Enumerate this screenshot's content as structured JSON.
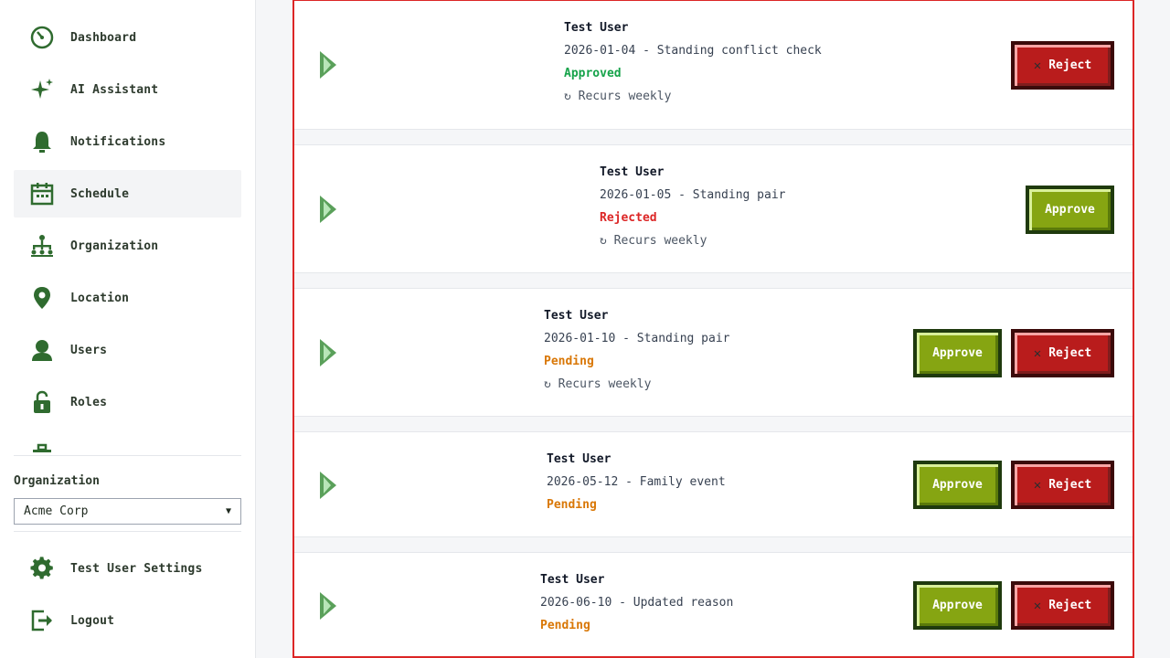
{
  "sidebar": {
    "items": [
      {
        "label": "Dashboard",
        "icon": "dashboard-icon"
      },
      {
        "label": "AI Assistant",
        "icon": "sparkle-icon"
      },
      {
        "label": "Notifications",
        "icon": "bell-icon"
      },
      {
        "label": "Schedule",
        "icon": "calendar-icon",
        "active": true
      },
      {
        "label": "Organization",
        "icon": "org-chart-icon"
      },
      {
        "label": "Location",
        "icon": "map-pin-icon"
      },
      {
        "label": "Users",
        "icon": "user-icon"
      },
      {
        "label": "Roles",
        "icon": "lock-icon"
      }
    ],
    "org_label": "Organization",
    "org_selected": "Acme Corp",
    "bottom": [
      {
        "label": "Test User Settings",
        "icon": "gear-icon"
      },
      {
        "label": "Logout",
        "icon": "logout-icon"
      }
    ]
  },
  "requests": [
    {
      "user": "Test User",
      "line": "2026-01-04 - Standing conflict check",
      "status": "Approved",
      "recur": "↻ Recurs weekly",
      "actions": [
        "Reject"
      ]
    },
    {
      "user": "Test User",
      "line": "2026-01-05 - Standing pair",
      "status": "Rejected",
      "recur": "↻ Recurs weekly",
      "actions": [
        "Approve"
      ]
    },
    {
      "user": "Test User",
      "line": "2026-01-10 - Standing pair",
      "status": "Pending",
      "recur": "↻ Recurs weekly",
      "actions": [
        "Approve",
        "Reject"
      ]
    },
    {
      "user": "Test User",
      "line": "2026-05-12 - Family event",
      "status": "Pending",
      "recur": "",
      "actions": [
        "Approve",
        "Reject"
      ]
    },
    {
      "user": "Test User",
      "line": "2026-06-10 - Updated reason",
      "status": "Pending",
      "recur": "",
      "actions": [
        "Approve",
        "Reject"
      ]
    }
  ],
  "buttons": {
    "approve": "Approve",
    "reject": "Reject",
    "reject_icon": "✕"
  },
  "colors": {
    "accent_green": "#86a512",
    "reject_red": "#b91c1c",
    "approved": "#16a34a",
    "rejected": "#dc2626",
    "pending": "#d97706"
  }
}
